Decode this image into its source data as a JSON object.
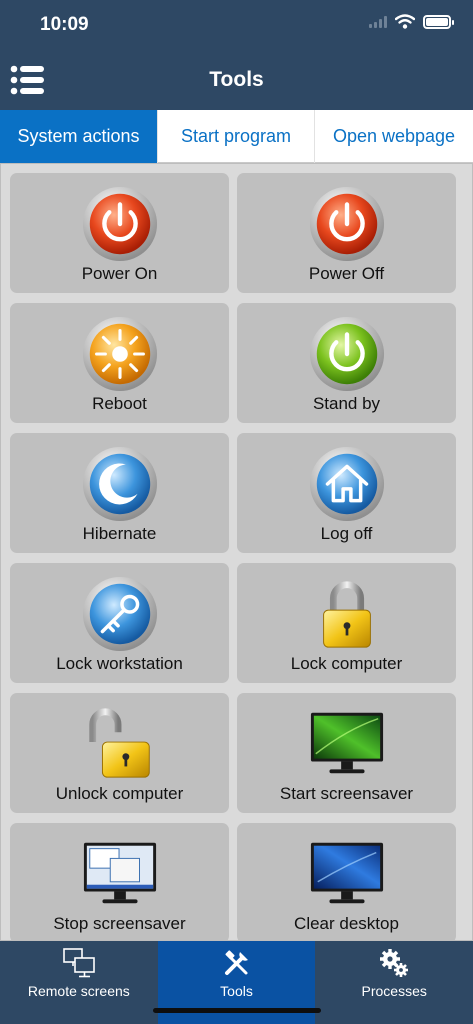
{
  "status": {
    "time": "10:09"
  },
  "header": {
    "title": "Tools",
    "menu_icon": "list-icon"
  },
  "tabs": [
    {
      "label": "System actions",
      "active": true
    },
    {
      "label": "Start program",
      "active": false
    },
    {
      "label": "Open webpage",
      "active": false
    }
  ],
  "actions": [
    {
      "label": "Power On",
      "icon": "power-on-icon"
    },
    {
      "label": "Power Off",
      "icon": "power-off-icon"
    },
    {
      "label": "Reboot",
      "icon": "reboot-icon"
    },
    {
      "label": "Stand by",
      "icon": "standby-icon"
    },
    {
      "label": "Hibernate",
      "icon": "moon-icon"
    },
    {
      "label": "Log off",
      "icon": "home-icon"
    },
    {
      "label": "Lock workstation",
      "icon": "key-icon"
    },
    {
      "label": "Lock computer",
      "icon": "padlock-closed-icon"
    },
    {
      "label": "Unlock computer",
      "icon": "padlock-open-icon"
    },
    {
      "label": "Start screensaver",
      "icon": "monitor-screensaver-icon"
    },
    {
      "label": "Stop screensaver",
      "icon": "monitor-desktop-icon"
    },
    {
      "label": "Clear desktop",
      "icon": "monitor-blue-icon"
    }
  ],
  "bottom_tabs": [
    {
      "label": "Remote screens",
      "icon": "monitors-icon",
      "active": false
    },
    {
      "label": "Tools",
      "icon": "tools-icon",
      "active": true
    },
    {
      "label": "Processes",
      "icon": "gears-icon",
      "active": false
    }
  ],
  "colors": {
    "bar": "#2e4864",
    "accent": "#0a71c5",
    "active_tab": "#0a52a3"
  }
}
